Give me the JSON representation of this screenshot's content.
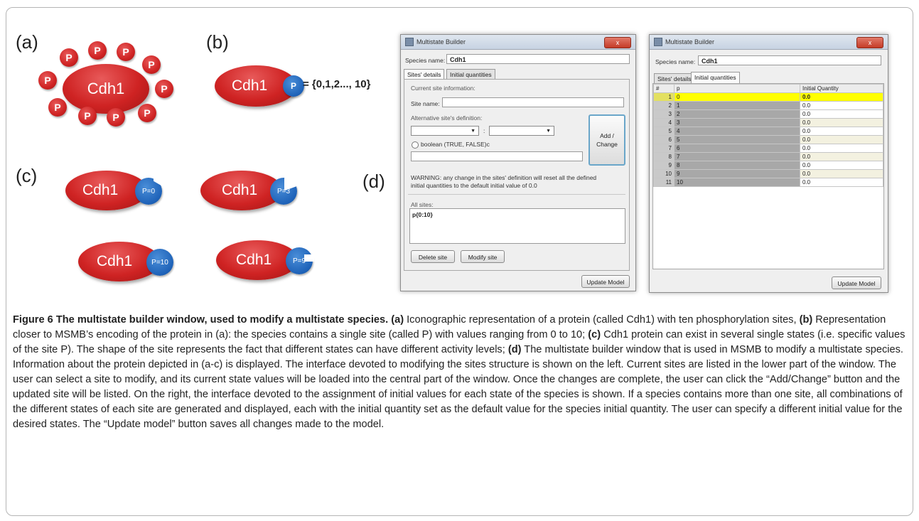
{
  "labels": {
    "a": "(a)",
    "b": "(b)",
    "c": "(c)",
    "d": "(d)"
  },
  "protein": "Cdh1",
  "phospho_mark": "P",
  "panel_b": {
    "site_label": "P",
    "values": "= {0,1,2..., 10}"
  },
  "panel_c": {
    "states": [
      "P=0",
      "P=3",
      "P=10",
      "P=9"
    ]
  },
  "window_left": {
    "title": "Multistate Builder",
    "close": "x",
    "species_label": "Species name:",
    "species_value": "Cdh1",
    "tabs": [
      "Sites' details",
      "Initial quantities"
    ],
    "current_site_info": "Current site information:",
    "site_name_label": "Site name:",
    "alt_def_label": "Alternative site's definition:",
    "range_sep": ":",
    "boolean_label": "boolean (TRUE, FALSE)c",
    "add_change": [
      "Add /",
      "Change"
    ],
    "warning": [
      "WARNING: any change in the sites' definition will reset all the defined",
      "initial quantities to the default initial value of 0.0"
    ],
    "all_sites_label": "All sites:",
    "all_sites_value": "p{0:10}",
    "delete_btn": "Delete site",
    "modify_btn": "Modify site",
    "update_btn": "Update Model"
  },
  "window_right": {
    "title": "Multistate Builder",
    "close": "x",
    "species_label": "Species name:",
    "species_value": "Cdh1",
    "tabs": [
      "Sites' details",
      "Initial quantities"
    ],
    "columns": [
      "#",
      "p",
      "Initial Quantity"
    ],
    "rows": [
      [
        "1",
        "0",
        "0.0"
      ],
      [
        "2",
        "1",
        "0.0"
      ],
      [
        "3",
        "2",
        "0.0"
      ],
      [
        "4",
        "3",
        "0.0"
      ],
      [
        "5",
        "4",
        "0.0"
      ],
      [
        "6",
        "5",
        "0.0"
      ],
      [
        "7",
        "6",
        "0.0"
      ],
      [
        "8",
        "7",
        "0.0"
      ],
      [
        "9",
        "8",
        "0.0"
      ],
      [
        "10",
        "9",
        "0.0"
      ],
      [
        "11",
        "10",
        "0.0"
      ]
    ],
    "update_btn": "Update Model"
  },
  "caption": {
    "title": "Figure 6 The multistate builder window, used to modify a multistate species.",
    "a_tag": "(a)",
    "a_text": " Iconographic representation of a protein (called Cdh1) with ten phosphorylation sites, ",
    "b_tag": "(b)",
    "b_text": " Representation closer to MSMB’s encoding of the protein in (a): the species contains a single site (called P) with values ranging from 0 to 10; ",
    "c_tag": "(c)",
    "c_text": " Cdh1 protein can exist in several single states (i.e. specific values of the site P). The shape of the site represents the fact that different states can have different activity levels; ",
    "d_tag": "(d)",
    "d_text": " The multistate builder window that is used in MSMB to modify a multistate species. Information about the protein depicted in (a-c) is displayed. The interface devoted to modifying the sites structure is shown on the left. Current sites are listed in the lower part of the window. The user can select a site to modify, and its current state values will be loaded into the central part of the window. Once the changes are complete, the user can click the “Add/Change” button and the updated site will be listed. On the right, the interface devoted to the assignment of initial values for each state of the species is shown. If a species contains more than one site, all combinations of the different states of each site are generated and displayed, each with the initial quantity set as the default value for the species initial quantity. The user can specify a different initial value for the desired states. The “Update model” button saves all changes made to the model."
  },
  "colors": {
    "protein_red": "#cf2323",
    "site_blue": "#1e62b8",
    "highlight_yellow": "#ffff00"
  }
}
